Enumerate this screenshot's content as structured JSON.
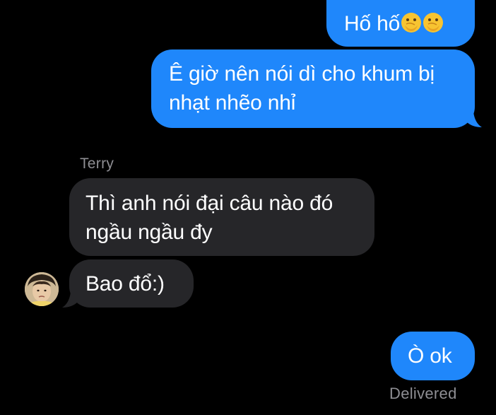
{
  "conversation": {
    "messages": [
      {
        "direction": "outgoing",
        "text": "Hố hố",
        "emoji": [
          "face-with-hand-over-mouth",
          "face-with-hand-over-mouth"
        ]
      },
      {
        "direction": "outgoing",
        "line1": "Ê giờ nên nói dì cho khum bị",
        "line2": "nhạt nhẽo nhỉ"
      },
      {
        "direction": "incoming",
        "sender": "Terry",
        "line1": "Thì anh nói đại câu nào đó",
        "line2": "ngầu ngầu đy"
      },
      {
        "direction": "incoming",
        "text": "Bao đổ:)"
      },
      {
        "direction": "outgoing",
        "text": "Ò ok",
        "status": "Delivered"
      }
    ]
  },
  "colors": {
    "background": "#000000",
    "outgoing_bubble": "#1f87fb",
    "incoming_bubble": "#262629",
    "meta_text": "#8e8e93"
  }
}
